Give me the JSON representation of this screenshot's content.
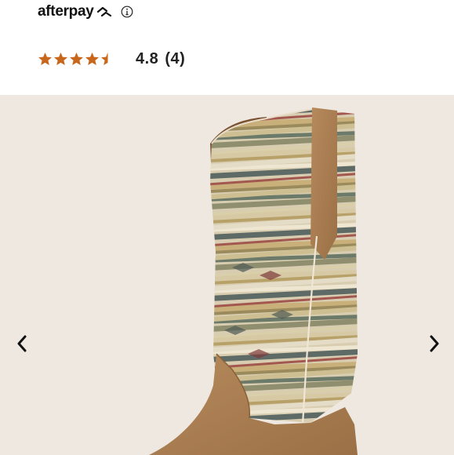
{
  "afterpay": {
    "logo_text": "afterpay",
    "info_icon": "info-icon"
  },
  "rating": {
    "stars": 4.5,
    "max_stars": 5,
    "star_color": "#c8671b",
    "value": "4.8",
    "count": "(4)"
  },
  "gallery": {
    "prev_icon": "chevron-left-icon",
    "next_icon": "chevron-right-icon",
    "background": "#efe8e0"
  }
}
